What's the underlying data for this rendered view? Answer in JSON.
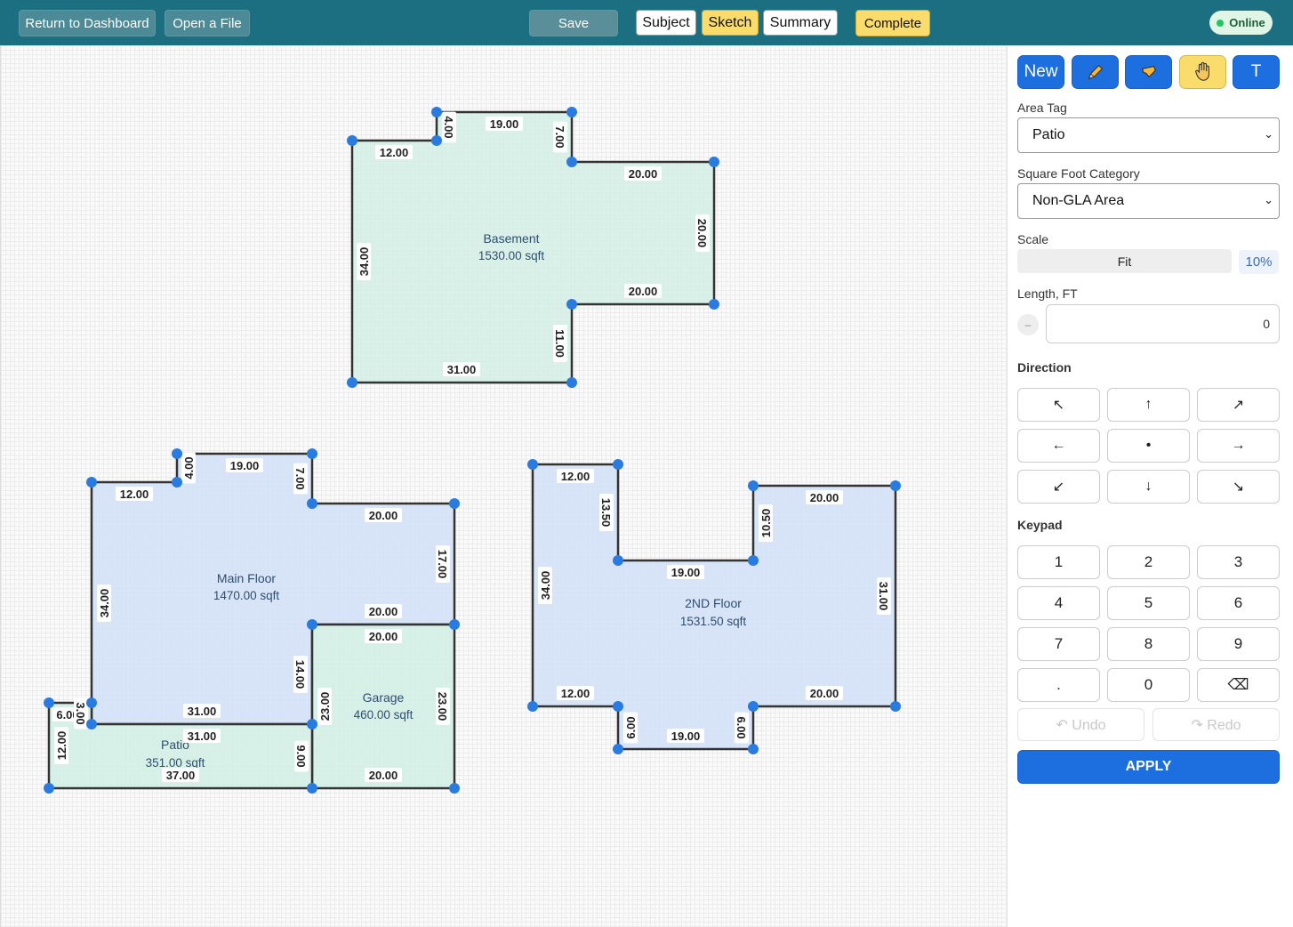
{
  "topbar": {
    "return_label": "Return to Dashboard",
    "open_label": "Open a File",
    "save_label": "Save",
    "subject_label": "Subject",
    "sketch_label": "Sketch",
    "summary_label": "Summary",
    "complete_label": "Complete",
    "status_label": "Online"
  },
  "tools": {
    "new_label": "New",
    "pencil_icon": "pencil-icon",
    "lasso_icon": "lasso-icon",
    "hand_icon": "hand-icon",
    "text_label": "T"
  },
  "panel": {
    "area_tag_label": "Area Tag",
    "area_tag_value": "Patio",
    "sqft_category_label": "Square Foot Category",
    "sqft_category_value": "Non-GLA Area",
    "scale_label": "Scale",
    "fit_label": "Fit",
    "scale_value": "10%",
    "length_label": "Length, FT",
    "minus_label": "–",
    "length_value": "0",
    "direction_label": "Direction",
    "directions": [
      "↖",
      "↑",
      "↗",
      "←",
      "•",
      "→",
      "↙",
      "↓",
      "↘"
    ],
    "keypad_label": "Keypad",
    "keys": [
      "1",
      "2",
      "3",
      "4",
      "5",
      "6",
      "7",
      "8",
      "9",
      ".",
      "0",
      "⌫"
    ],
    "undo_label": "↶ Undo",
    "redo_label": "↷ Redo",
    "apply_label": "APPLY"
  },
  "colors": {
    "topbar": "#1b6f80",
    "accent_blue": "#1d6fe0",
    "accent_yellow": "#f9dc6b",
    "green_fill": "#d4efe5",
    "blue_fill": "#d4e2f7",
    "vertex": "#2a7be0"
  },
  "sketch": {
    "basement": {
      "name": "Basement",
      "area": "1530.00 sqft",
      "labels": [
        "12.00",
        "4.00",
        "19.00",
        "7.00",
        "20.00",
        "20.00",
        "20.00",
        "11.00",
        "31.00",
        "34.00"
      ]
    },
    "main_floor": {
      "name": "Main Floor",
      "area": "1470.00 sqft",
      "labels": [
        "12.00",
        "4.00",
        "19.00",
        "7.00",
        "20.00",
        "17.00",
        "20.00",
        "14.00",
        "31.00",
        "34.00"
      ]
    },
    "garage": {
      "name": "Garage",
      "area": "460.00 sqft",
      "labels": [
        "20.00",
        "23.00",
        "20.00",
        "23.00"
      ]
    },
    "patio": {
      "name": "Patio",
      "area": "351.00 sqft",
      "labels": [
        "6.00",
        "3.00",
        "31.00",
        "9.00",
        "37.00",
        "12.00"
      ]
    },
    "second_floor": {
      "name": "2ND Floor",
      "area": "1531.50 sqft",
      "labels": [
        "12.00",
        "13.50",
        "19.00",
        "10.50",
        "20.00",
        "31.00",
        "20.00",
        "6.00",
        "19.00",
        "6.00",
        "12.00",
        "34.00"
      ]
    }
  }
}
